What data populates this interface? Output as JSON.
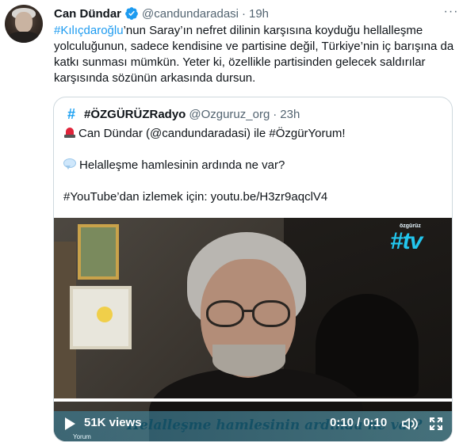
{
  "tweet": {
    "author_name": "Can Dündar",
    "handle": "@candundaradasi",
    "separator": "·",
    "time": "19h",
    "more_label": "···",
    "body": {
      "hashtag": "#Kılıçdaroğlu",
      "text": "’nun Saray’ın nefret dilinin karşısına koyduğu hellalleşme yolculuğunun, sadece kendisine ve partisine değil, Türkiye’nin iç barışına da katkı sunması mümkün. Yeter ki, özellikle partisinden gelecek saldırılar karşısında sözünün arkasında dursun."
    }
  },
  "quote": {
    "avatar_glyph": "#",
    "author_name": "#ÖZGÜRÜZRadyo",
    "handle": "@Ozguruz_org",
    "separator": "·",
    "time": "23h",
    "line1": "Can Dündar (@candundaradasi) ile #ÖzgürYorum!",
    "line2": "Helalleşme hamlesinin ardında ne var?",
    "line3": "#YouTube’dan izlemek için: youtu.be/H3zr9aqclV4",
    "line1_icon": "siren-icon",
    "line2_icon": "speech-bubble-icon"
  },
  "video": {
    "logo_small": "özgürüz",
    "logo_text": "#tv",
    "banner_text": "Helalleşme hamlesinin ardında ne var?",
    "corner_tag": "Yorum",
    "views": "51K views",
    "current_time": "0:10",
    "time_separator": "/",
    "duration": "0:10",
    "progress": 1.0,
    "colors": {
      "logo": "#22c6ee",
      "banner": "#0c4c63"
    }
  },
  "colors": {
    "link": "#1d9bf0",
    "verified": "#1d9bf0",
    "muted": "#536471",
    "border": "#cfd9de"
  }
}
